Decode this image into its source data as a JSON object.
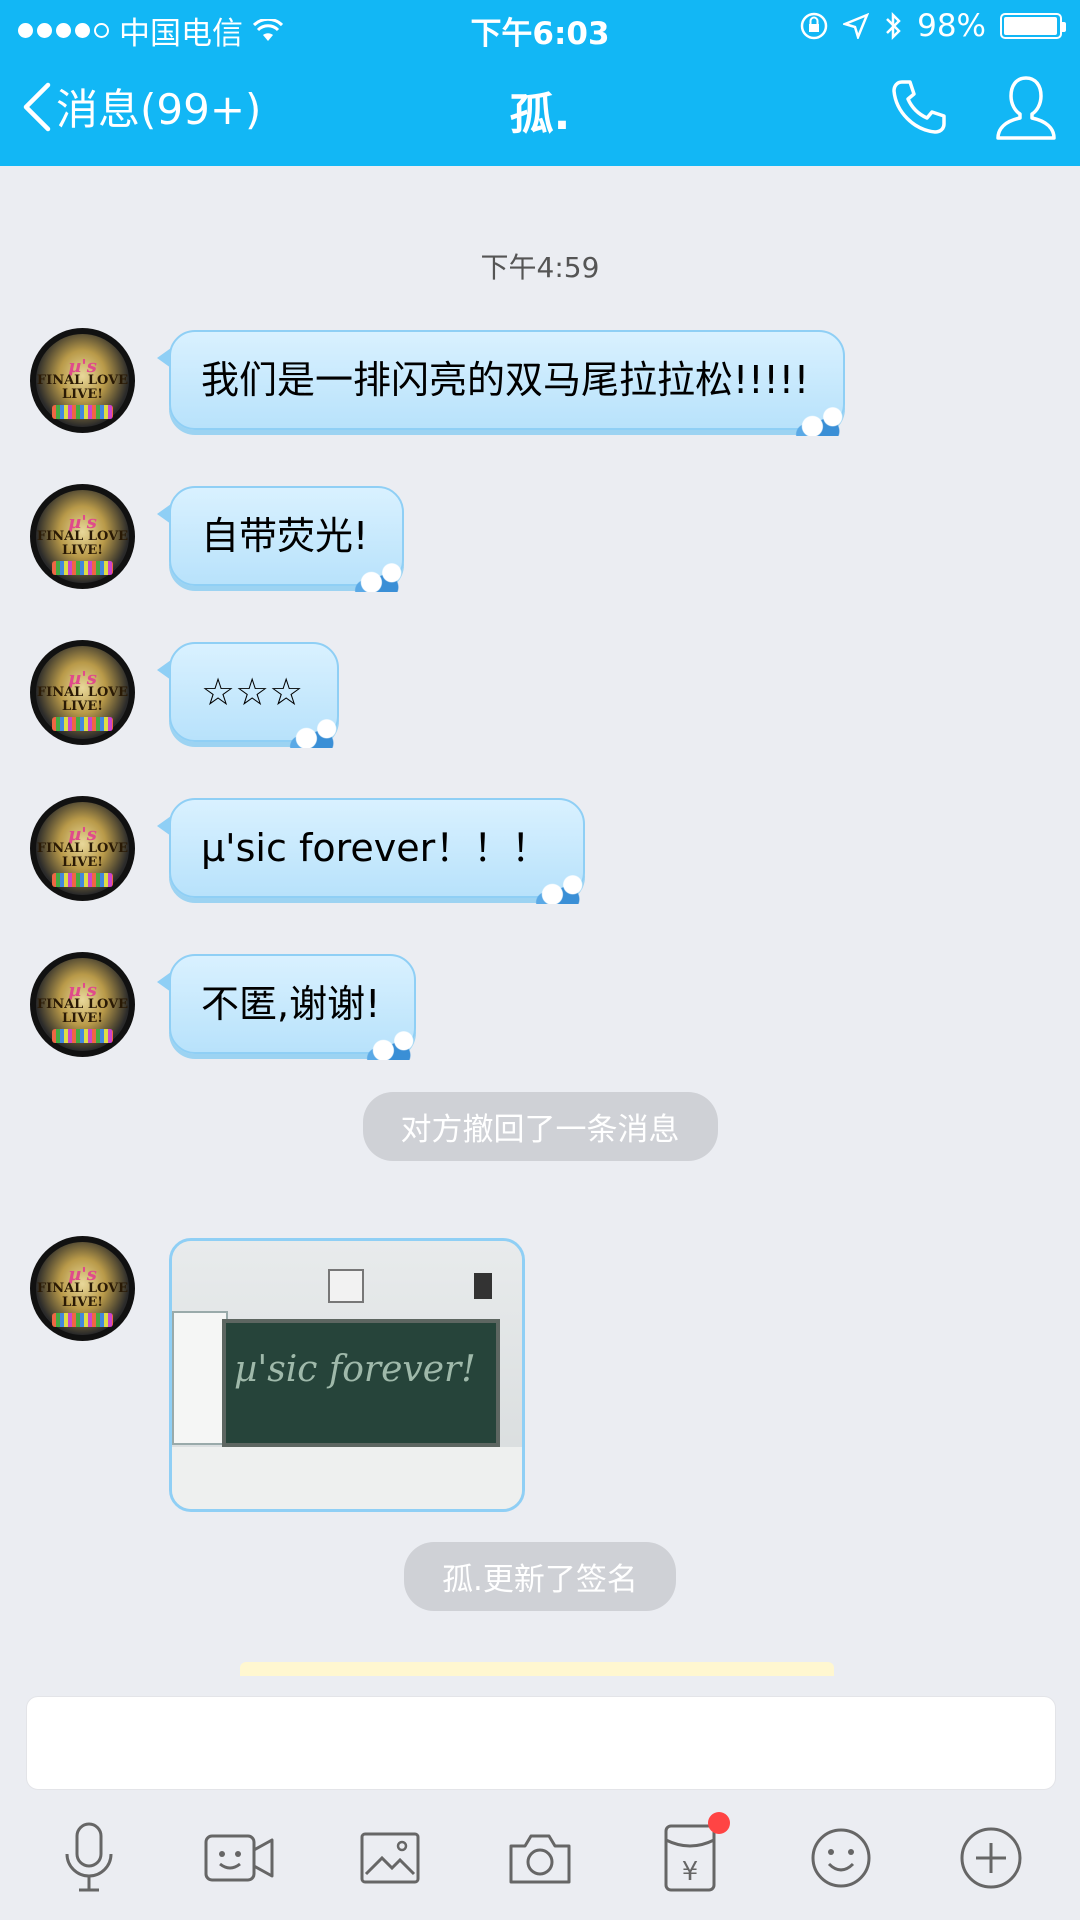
{
  "status": {
    "carrier": "中国电信",
    "time": "下午6:03",
    "battery": "98%"
  },
  "nav": {
    "back_label": "消息(99+)",
    "title": "孤."
  },
  "chat": {
    "timestamp": "下午4:59",
    "messages": [
      {
        "text": "我们是一排闪亮的双马尾拉拉松!!!!!"
      },
      {
        "text": "自带荧光!"
      },
      {
        "text": "☆☆☆"
      },
      {
        "text": "µ'sic forever！！！"
      },
      {
        "text": "不匿,谢谢!"
      }
    ],
    "recall_notice": "对方撤回了一条消息",
    "photo_caption": "µ'sic forever!",
    "signature_notice": "孤.更新了签名"
  },
  "input": {
    "value": ""
  },
  "toolbar": {
    "icons": [
      "microphone-icon",
      "video-icon",
      "image-icon",
      "camera-icon",
      "red-packet-icon",
      "emoji-icon",
      "plus-icon"
    ],
    "red_packet_symbol": "¥"
  }
}
